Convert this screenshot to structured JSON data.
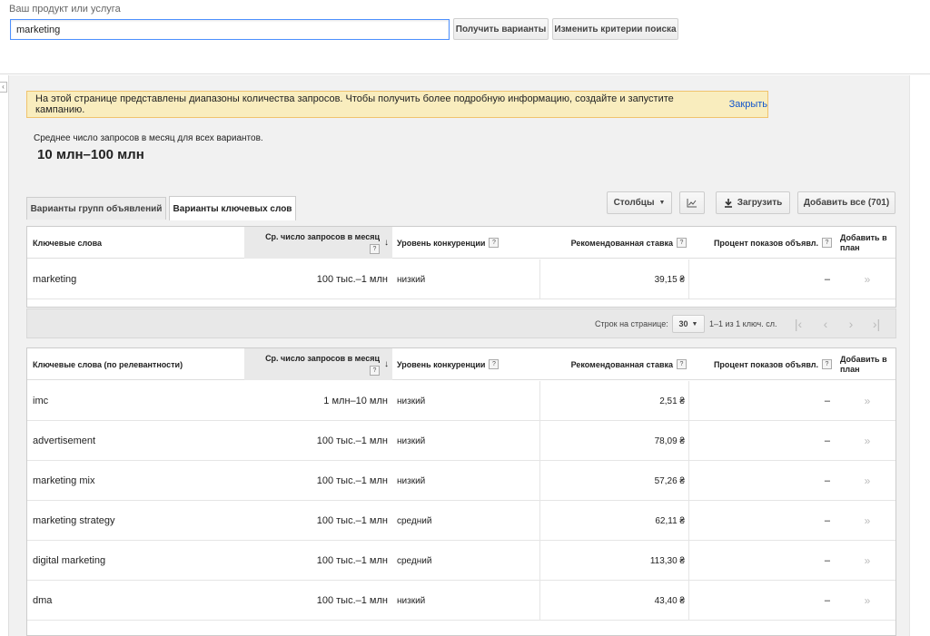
{
  "search": {
    "label": "Ваш продукт или услуга",
    "value": "marketing",
    "get_button": "Получить варианты",
    "change_button": "Изменить критерии поиска"
  },
  "notice": {
    "text": "На этой странице представлены диапазоны количества запросов. Чтобы получить более подробную информацию, создайте и запустите кампанию.",
    "link": "Закрыть"
  },
  "summary": {
    "label": "Среднее число запросов в месяц для всех вариантов.",
    "value": "10 млн–100 млн"
  },
  "tabs": [
    {
      "label": "Варианты групп объявлений",
      "active": false
    },
    {
      "label": "Варианты ключевых слов",
      "active": true
    }
  ],
  "toolbar": {
    "columns": "Столбцы",
    "download": "Загрузить",
    "add_all": "Добавить все (701)"
  },
  "headers": {
    "keywords": "Ключевые слова",
    "keywords_relevance": "Ключевые слова (по релевантности)",
    "avg_line1": "Ср. число запросов в месяц",
    "competition": "Уровень конкуренции",
    "bid": "Рекомендованная ставка",
    "share": "Процент показов объявл.",
    "add_line1": "Добавить в",
    "add_line2": "план",
    "help": "?"
  },
  "searched_rows": [
    {
      "keyword": "marketing",
      "avg": "100 тыс.–1 млн",
      "competition": "низкий",
      "bid": "39,15 ₴",
      "share": "–",
      "add": "»"
    }
  ],
  "pager": {
    "rows_label": "Строк на странице:",
    "rows_value": "30",
    "range": "1–1 из 1 ключ. сл."
  },
  "idea_rows": [
    {
      "keyword": "imc",
      "avg": "1 млн–10 млн",
      "competition": "низкий",
      "bid": "2,51 ₴",
      "share": "–",
      "add": "»"
    },
    {
      "keyword": "advertisement",
      "avg": "100 тыс.–1 млн",
      "competition": "низкий",
      "bid": "78,09 ₴",
      "share": "–",
      "add": "»"
    },
    {
      "keyword": "marketing mix",
      "avg": "100 тыс.–1 млн",
      "competition": "низкий",
      "bid": "57,26 ₴",
      "share": "–",
      "add": "»"
    },
    {
      "keyword": "marketing strategy",
      "avg": "100 тыс.–1 млн",
      "competition": "средний",
      "bid": "62,11 ₴",
      "share": "–",
      "add": "»"
    },
    {
      "keyword": "digital marketing",
      "avg": "100 тыс.–1 млн",
      "competition": "средний",
      "bid": "113,30 ₴",
      "share": "–",
      "add": "»"
    },
    {
      "keyword": "dma",
      "avg": "100 тыс.–1 млн",
      "competition": "низкий",
      "bid": "43,40 ₴",
      "share": "–",
      "add": "»"
    }
  ]
}
